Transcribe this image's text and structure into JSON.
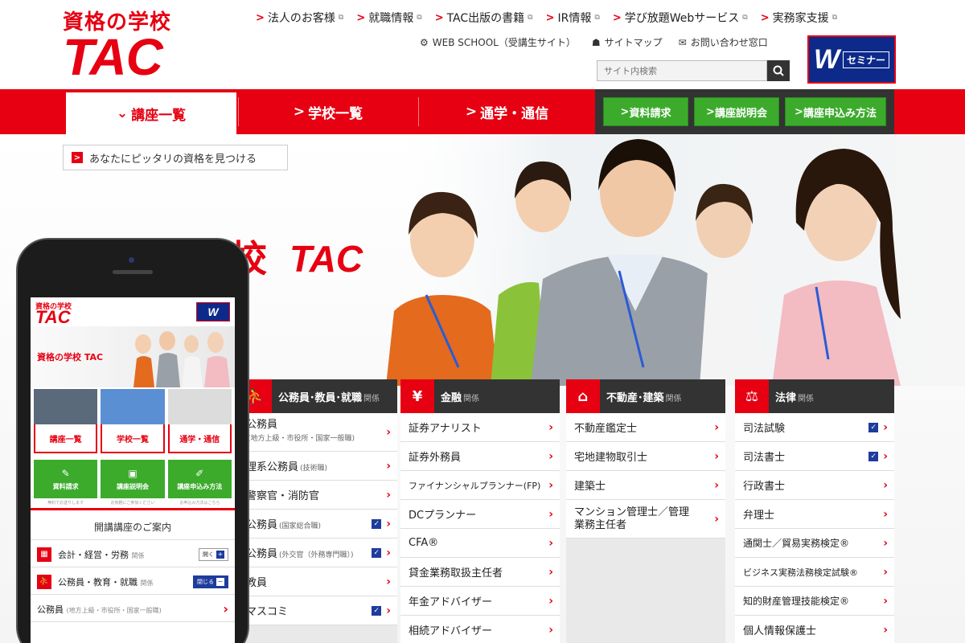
{
  "logo": {
    "top": "資格の学校",
    "main": "TAC"
  },
  "top_links": [
    {
      "label": "法人のお客様"
    },
    {
      "label": "就職情報"
    },
    {
      "label": "TAC出版の書籍"
    },
    {
      "label": "IR情報"
    },
    {
      "label": "学び放題Webサービス"
    },
    {
      "label": "実務家支援"
    }
  ],
  "sub_links": [
    {
      "label": "WEB SCHOOL（受講生サイト）",
      "icon": "gear-icon"
    },
    {
      "label": "サイトマップ",
      "icon": "sitemap-icon"
    },
    {
      "label": "お問い合わせ窓口",
      "icon": "mail-icon"
    }
  ],
  "search": {
    "placeholder": "サイト内検索"
  },
  "wseminar": {
    "label": "セミナー"
  },
  "nav": {
    "tabs": [
      {
        "label": "講座一覧",
        "active": true
      },
      {
        "label": "学校一覧",
        "active": false
      },
      {
        "label": "通学・通信",
        "active": false
      }
    ],
    "buttons": [
      {
        "label": "資料請求"
      },
      {
        "label": "講座説明会"
      },
      {
        "label": "講座申込み方法"
      }
    ]
  },
  "hero": {
    "find_label": "あなたにピッタリの資格を見つける",
    "title": "資格の学校",
    "title_tac": "TAC"
  },
  "cards": [
    {
      "title": "公務員･教員･就職",
      "kan": "関係",
      "icon": "person-icon",
      "items": [
        {
          "label": "公務員",
          "note": "(地方上級・市役所・国家一般職)",
          "check": false
        },
        {
          "label": "理系公務員",
          "note": "(技術職)",
          "check": false
        },
        {
          "label": "警察官・消防官",
          "note": "",
          "check": false
        },
        {
          "label": "公務員",
          "note": "(国家総合職)",
          "check": true
        },
        {
          "label": "公務員",
          "note": "(外交官（外務専門職）)",
          "check": true
        },
        {
          "label": "教員",
          "note": "",
          "check": false
        },
        {
          "label": "マスコミ",
          "note": "",
          "check": true
        }
      ]
    },
    {
      "title": "金融",
      "kan": "関係",
      "icon": "yen-icon",
      "items": [
        {
          "label": "証券アナリスト",
          "note": "",
          "check": false
        },
        {
          "label": "証券外務員",
          "note": "",
          "check": false
        },
        {
          "label": "ファイナンシャルプランナー(FP)",
          "note": "",
          "check": false
        },
        {
          "label": "DCプランナー",
          "note": "",
          "check": false
        },
        {
          "label": "CFA®",
          "note": "",
          "check": false
        },
        {
          "label": "貸金業務取扱主任者",
          "note": "",
          "check": false
        },
        {
          "label": "年金アドバイザー",
          "note": "",
          "check": false
        },
        {
          "label": "相続アドバイザー",
          "note": "",
          "check": false
        }
      ]
    },
    {
      "title": "不動産･建築",
      "kan": "関係",
      "icon": "house-icon",
      "items": [
        {
          "label": "不動産鑑定士",
          "note": "",
          "check": false
        },
        {
          "label": "宅地建物取引士",
          "note": "",
          "check": false
        },
        {
          "label": "建築士",
          "note": "",
          "check": false
        },
        {
          "label": "マンション管理士／管理業務主任者",
          "note": "",
          "check": false,
          "tall": true
        }
      ]
    },
    {
      "title": "法律",
      "kan": "関係",
      "icon": "scales-icon",
      "items": [
        {
          "label": "司法試験",
          "note": "",
          "check": true
        },
        {
          "label": "司法書士",
          "note": "",
          "check": true
        },
        {
          "label": "行政書士",
          "note": "",
          "check": false
        },
        {
          "label": "弁理士",
          "note": "",
          "check": false
        },
        {
          "label": "通関士／貿易実務検定®",
          "note": "",
          "check": false
        },
        {
          "label": "ビジネス実務法務検定試験®",
          "note": "",
          "check": false
        },
        {
          "label": "知的財産管理技能検定®",
          "note": "",
          "check": false
        },
        {
          "label": "個人情報保護士",
          "note": "",
          "check": false
        }
      ]
    }
  ],
  "phone": {
    "logo_top": "資格の学校",
    "logo_main": "TAC",
    "hero_title": "資格の学校 TAC",
    "tiles": [
      "講座一覧",
      "学校一覧",
      "通学・通信"
    ],
    "green": [
      "資料請求",
      "講座説明会",
      "講座申込み方法"
    ],
    "captions": [
      "無料でお送りします",
      "お気軽にご参加ください",
      "お申込み方法はこちら"
    ],
    "heading": "開講講座のご案内",
    "rows": [
      {
        "label": "会計・経営・労務",
        "kan": "関係",
        "toggle": "開く",
        "sign": "+"
      },
      {
        "label": "公務員・教育・就職",
        "kan": "関係",
        "toggle": "閉じる",
        "sign": "−"
      }
    ],
    "sub_item": {
      "label": "公務員",
      "note": "(地方上級・市役所・国家一般職)"
    }
  }
}
